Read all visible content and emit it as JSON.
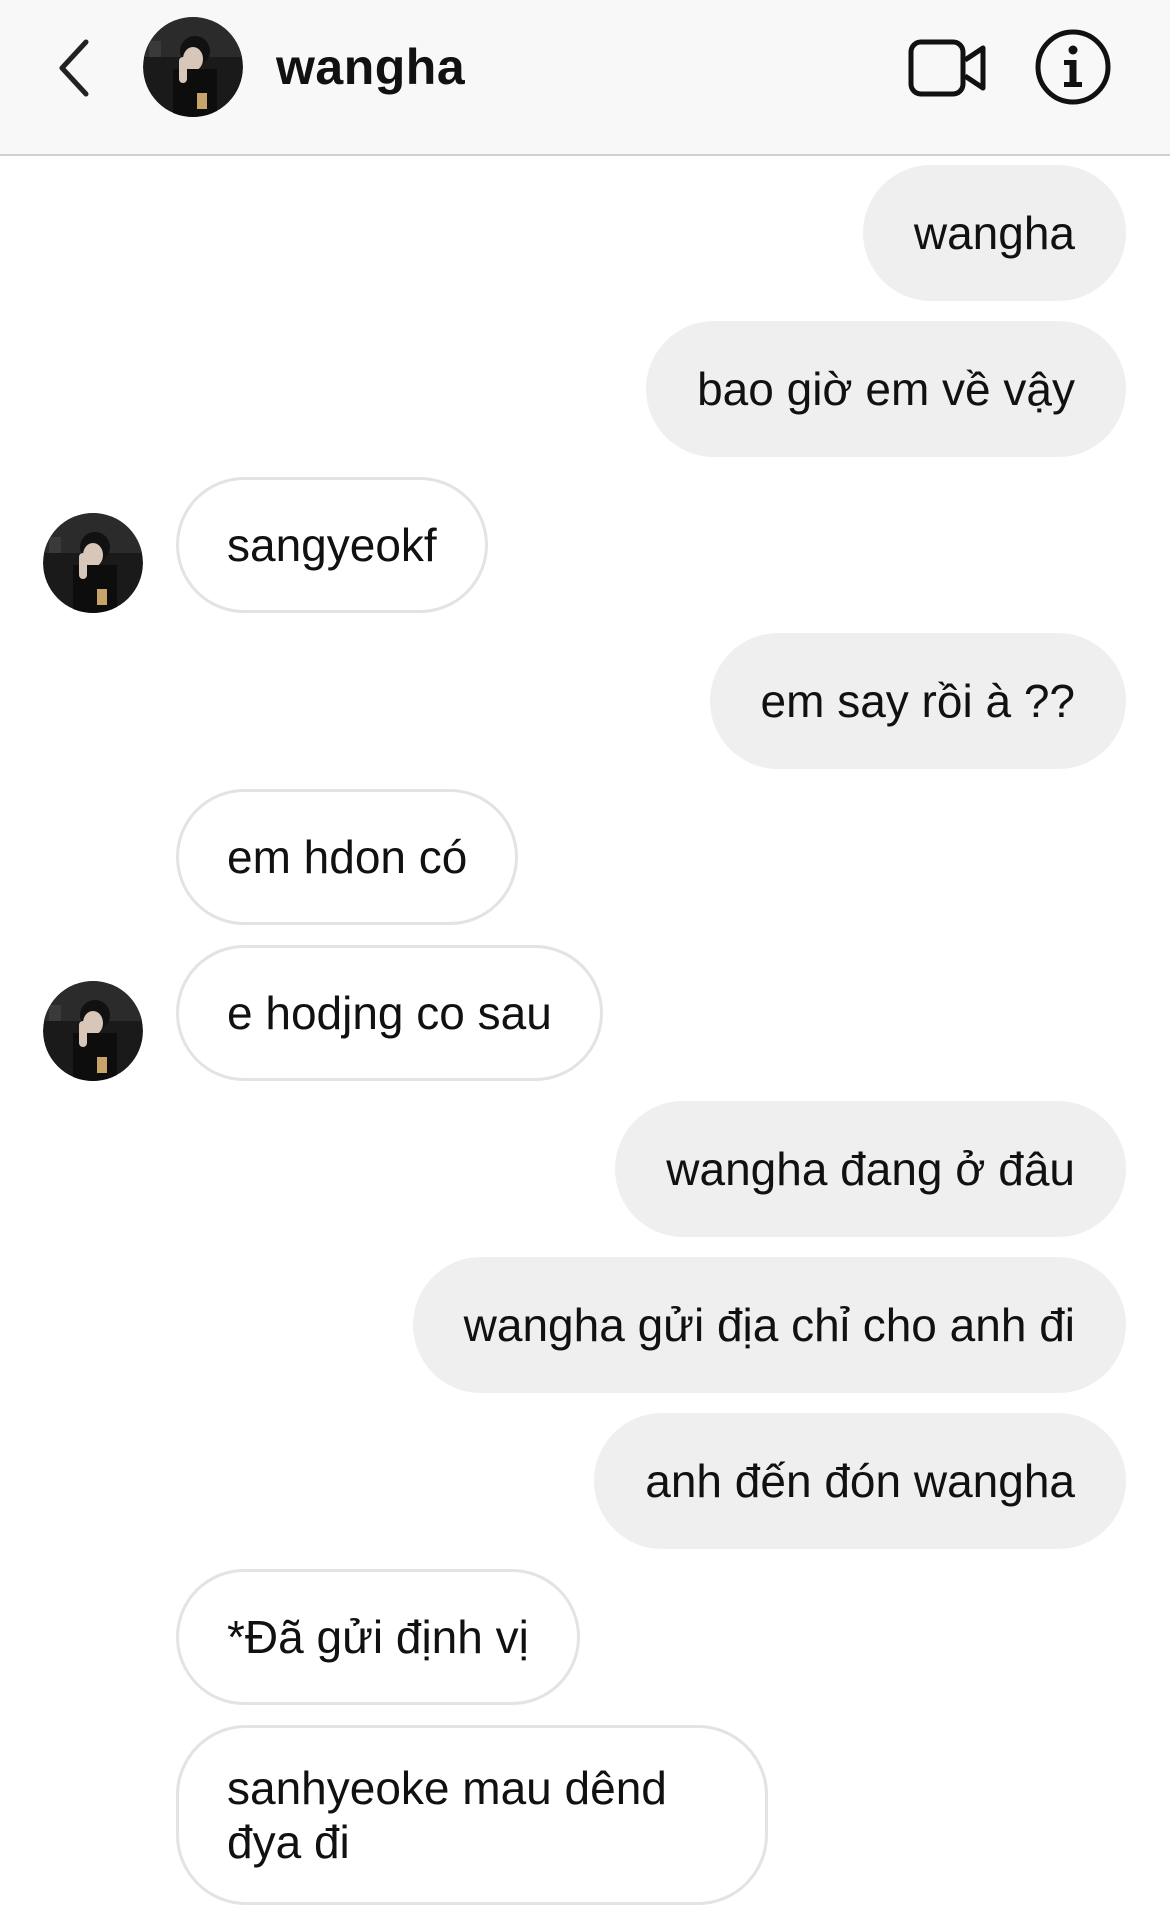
{
  "header": {
    "title": "wangha",
    "icons": {
      "back": "chevron-left-icon",
      "video": "video-camera-icon",
      "info": "info-icon"
    }
  },
  "messages": [
    {
      "from": "me",
      "text": "wangha"
    },
    {
      "from": "me",
      "text": "bao giờ em về vậy"
    },
    {
      "from": "them",
      "text": "sangyeokf"
    },
    {
      "from": "me",
      "text": "em say rồi à ??"
    },
    {
      "from": "them",
      "text": "em hdon có"
    },
    {
      "from": "them",
      "text": "e hodjng co sau"
    },
    {
      "from": "me",
      "text": "wangha đang ở đâu"
    },
    {
      "from": "me",
      "text": "wangha gửi địa chỉ cho anh đi"
    },
    {
      "from": "me",
      "text": "anh đến đón wangha"
    },
    {
      "from": "them",
      "text": "*Đã gửi định vị"
    },
    {
      "from": "them",
      "text": "sanhyeoke mau dênd\nđya đi"
    }
  ],
  "colors": {
    "header_bg": "#f8f8f8",
    "outgoing_bubble": "#efefef",
    "incoming_border": "#e3e3e3",
    "text": "#111111"
  }
}
